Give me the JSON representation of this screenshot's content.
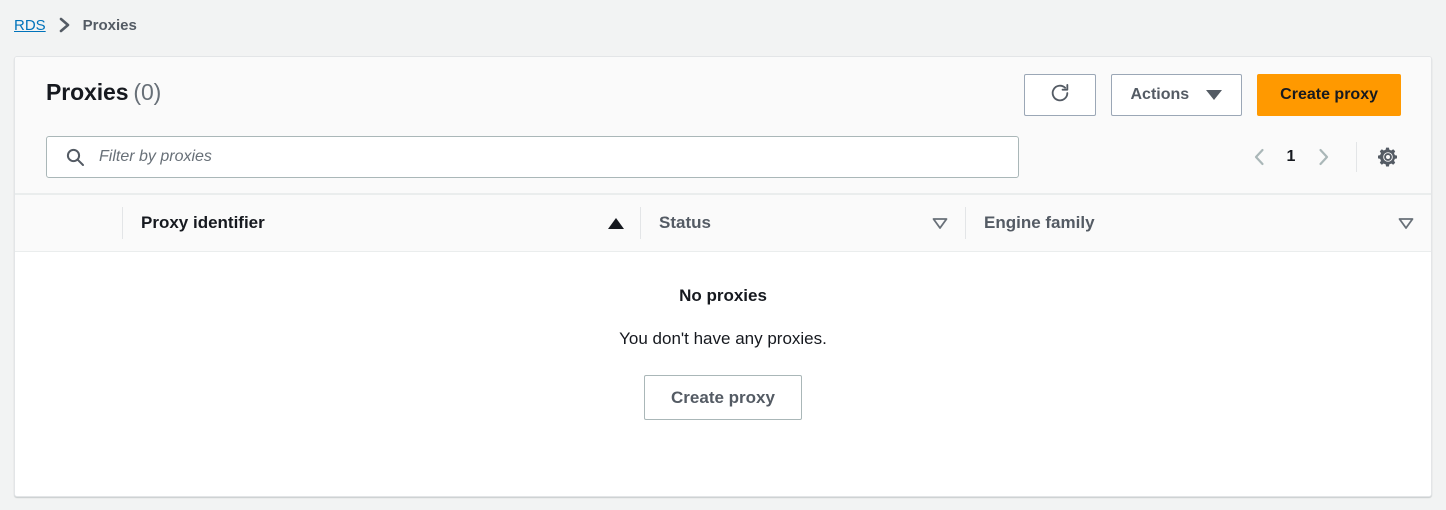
{
  "breadcrumb": {
    "root_label": "RDS",
    "separator": "chevron-right-icon",
    "current_label": "Proxies"
  },
  "panel": {
    "title": "Proxies",
    "count": "(0)",
    "toolbar": {
      "refresh_icon": "refresh-icon",
      "actions_label": "Actions",
      "create_label": "Create proxy"
    },
    "filter": {
      "placeholder": "Filter by proxies",
      "value": "",
      "search_icon": "search-icon"
    },
    "pagination": {
      "prev_icon": "chevron-left-icon",
      "page": "1",
      "next_icon": "chevron-right-icon",
      "settings_icon": "gear-icon"
    },
    "table": {
      "columns": [
        {
          "label": "Proxy identifier",
          "sort": "ascending"
        },
        {
          "label": "Status",
          "sort": "none"
        },
        {
          "label": "Engine family",
          "sort": "none"
        }
      ],
      "rows": []
    },
    "empty_state": {
      "title": "No proxies",
      "description": "You don't have any proxies.",
      "action_label": "Create proxy"
    }
  },
  "colors": {
    "page_background": "#f2f3f3",
    "panel_background": "#ffffff",
    "toolbar_background": "#fafafa",
    "primary_button": "#ff9900",
    "link": "#0073bb",
    "text_primary": "#16191f",
    "text_secondary": "#545b64",
    "border": "#e3e5e7"
  }
}
